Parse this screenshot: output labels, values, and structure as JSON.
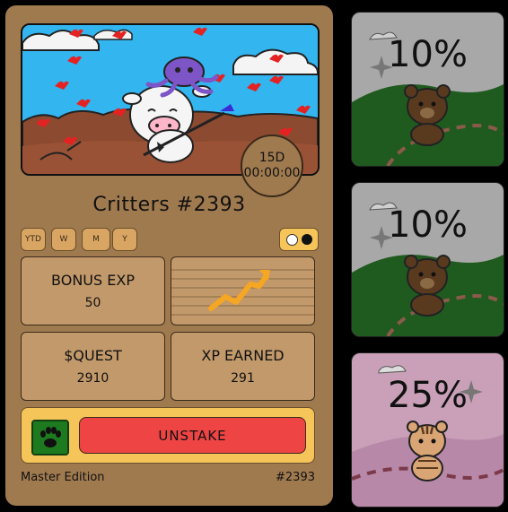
{
  "card": {
    "timer_days": "15D",
    "timer_clock": "00:00:00",
    "name": "Critters #2393",
    "periods": [
      "YTD",
      "W",
      "M",
      "Y"
    ],
    "stats": [
      {
        "label": "BONUS EXP",
        "value": "50"
      },
      {
        "label": "$QUEST",
        "value": "2910"
      },
      {
        "label": "XP EARNED",
        "value": "291"
      }
    ],
    "unstake_label": "UNSTAKE",
    "edition": "Master Edition",
    "number": "#2393"
  },
  "side_cards": [
    {
      "percent": "10%"
    },
    {
      "percent": "10%"
    },
    {
      "percent": "25%"
    }
  ],
  "colors": {
    "card_bg": "#a07a4f",
    "panel_bg": "#c2996a",
    "accent_yellow": "#f6c55a",
    "unstake_red": "#ee4444",
    "stamp_green": "#1e7a1e",
    "trend_orange": "#f5a623"
  }
}
